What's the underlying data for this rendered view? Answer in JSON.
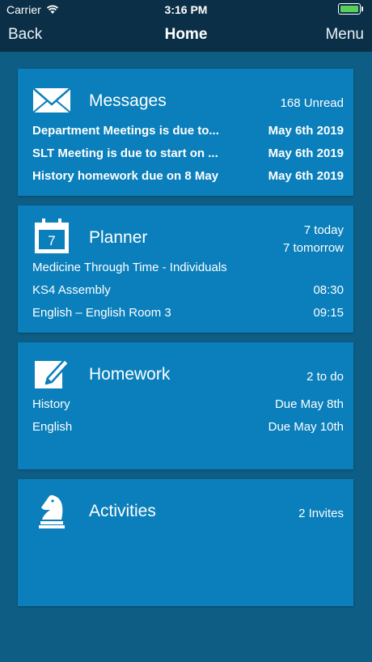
{
  "status": {
    "carrier": "Carrier",
    "time": "3:16 PM"
  },
  "nav": {
    "back": "Back",
    "title": "Home",
    "menu": "Menu"
  },
  "messages": {
    "title": "Messages",
    "summary": "168 Unread",
    "icon": "envelope-icon",
    "rows": [
      {
        "text": "Department Meetings is due to...",
        "date": "May 6th 2019"
      },
      {
        "text": "SLT Meeting is due to start on ...",
        "date": "May 6th 2019"
      },
      {
        "text": "History homework due on 8 May",
        "date": "May 6th 2019"
      }
    ]
  },
  "planner": {
    "title": "Planner",
    "icon": "calendar-icon",
    "calendar_day": "7",
    "summary_today": "7 today",
    "summary_tomorrow": "7 tomorrow",
    "rows": [
      {
        "text": "Medicine Through Time - Individuals",
        "time": ""
      },
      {
        "text": "KS4 Assembly",
        "time": "08:30"
      },
      {
        "text": "English – English Room 3",
        "time": "09:15"
      }
    ]
  },
  "homework": {
    "title": "Homework",
    "icon": "edit-icon",
    "summary": "2 to do",
    "rows": [
      {
        "subject": "History",
        "due": "Due May 8th"
      },
      {
        "subject": "English",
        "due": "Due May 10th"
      }
    ]
  },
  "activities": {
    "title": "Activities",
    "icon": "chess-knight-icon",
    "summary": "2 Invites"
  },
  "colors": {
    "background": "#0d5d85",
    "card": "#0a7fbb",
    "bar": "#0b2f46",
    "battery": "#58d15b"
  }
}
